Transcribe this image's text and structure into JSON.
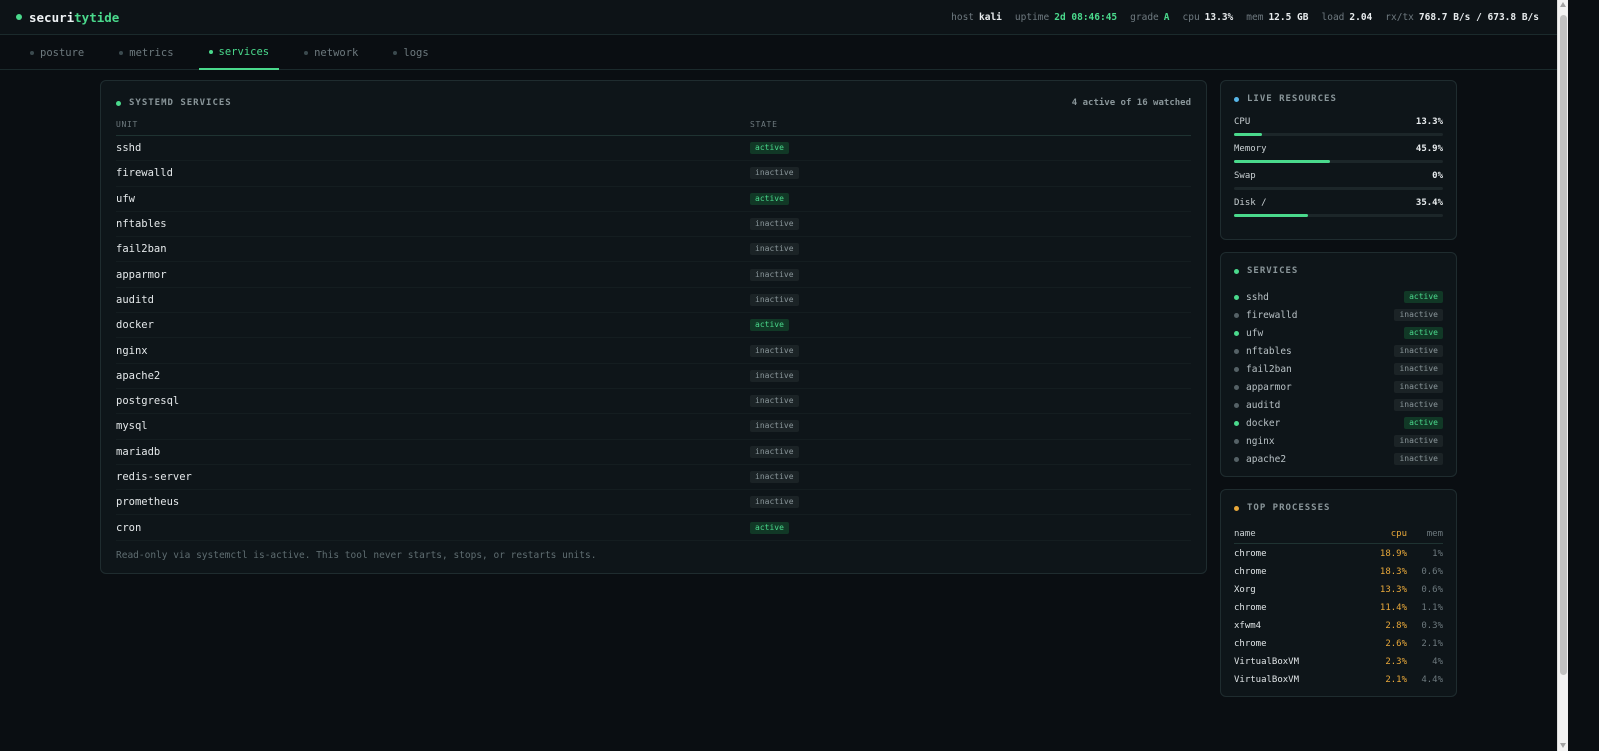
{
  "brand": {
    "prefix": "securi",
    "accent": "tytide"
  },
  "stats": [
    {
      "key": "host",
      "value": "kali"
    },
    {
      "key": "uptime",
      "value": "2d 08:46:45"
    },
    {
      "key": "grade",
      "value": "A"
    },
    {
      "key": "cpu",
      "value": "13.3%"
    },
    {
      "key": "mem",
      "value": "12.5 GB"
    },
    {
      "key": "load",
      "value": "2.04"
    },
    {
      "key": "rx/tx",
      "value": "768.7 B/s / 673.8 B/s"
    }
  ],
  "tabs": [
    "posture",
    "metrics",
    "services",
    "network",
    "logs"
  ],
  "active_tab": "services",
  "main": {
    "title": "SYSTEMD SERVICES",
    "count": "4 active of 16 watched",
    "col_unit": "UNIT",
    "col_state": "STATE",
    "rows": [
      {
        "unit": "sshd",
        "state": "active"
      },
      {
        "unit": "firewalld",
        "state": "inactive"
      },
      {
        "unit": "ufw",
        "state": "active"
      },
      {
        "unit": "nftables",
        "state": "inactive"
      },
      {
        "unit": "fail2ban",
        "state": "inactive"
      },
      {
        "unit": "apparmor",
        "state": "inactive"
      },
      {
        "unit": "auditd",
        "state": "inactive"
      },
      {
        "unit": "docker",
        "state": "active"
      },
      {
        "unit": "nginx",
        "state": "inactive"
      },
      {
        "unit": "apache2",
        "state": "inactive"
      },
      {
        "unit": "postgresql",
        "state": "inactive"
      },
      {
        "unit": "mysql",
        "state": "inactive"
      },
      {
        "unit": "mariadb",
        "state": "inactive"
      },
      {
        "unit": "redis-server",
        "state": "inactive"
      },
      {
        "unit": "prometheus",
        "state": "inactive"
      },
      {
        "unit": "cron",
        "state": "active"
      }
    ],
    "footer": "Read-only via systemctl is-active. This tool never starts, stops, or restarts units."
  },
  "resources": {
    "title": "LIVE RESOURCES",
    "items": [
      {
        "label": "CPU",
        "value": "13.3%",
        "fraction": 0.133
      },
      {
        "label": "Memory",
        "value": "45.9%",
        "fraction": 0.459
      },
      {
        "label": "Swap",
        "value": "0%",
        "fraction": 0
      },
      {
        "label": "Disk /",
        "value": "35.4%",
        "fraction": 0.354
      }
    ]
  },
  "side_services": {
    "title": "SERVICES",
    "items": [
      {
        "unit": "sshd",
        "state": "active"
      },
      {
        "unit": "firewalld",
        "state": "inactive"
      },
      {
        "unit": "ufw",
        "state": "active"
      },
      {
        "unit": "nftables",
        "state": "inactive"
      },
      {
        "unit": "fail2ban",
        "state": "inactive"
      },
      {
        "unit": "apparmor",
        "state": "inactive"
      },
      {
        "unit": "auditd",
        "state": "inactive"
      },
      {
        "unit": "docker",
        "state": "active"
      },
      {
        "unit": "nginx",
        "state": "inactive"
      },
      {
        "unit": "apache2",
        "state": "inactive"
      }
    ]
  },
  "processes": {
    "title": "TOP PROCESSES",
    "headers": {
      "name": "name",
      "cpu": "cpu",
      "mem": "mem"
    },
    "rows": [
      {
        "name": "chrome",
        "cpu": "18.9%",
        "mem": "1%"
      },
      {
        "name": "chrome",
        "cpu": "18.3%",
        "mem": "0.6%"
      },
      {
        "name": "Xorg",
        "cpu": "13.3%",
        "mem": "0.6%"
      },
      {
        "name": "chrome",
        "cpu": "11.4%",
        "mem": "1.1%"
      },
      {
        "name": "xfwm4",
        "cpu": "2.8%",
        "mem": "0.3%"
      },
      {
        "name": "chrome",
        "cpu": "2.6%",
        "mem": "2.1%"
      },
      {
        "name": "VirtualBoxVM",
        "cpu": "2.3%",
        "mem": "4%"
      },
      {
        "name": "VirtualBoxVM",
        "cpu": "2.1%",
        "mem": "4.4%"
      }
    ]
  },
  "colors": {
    "accent": "#4ad98c",
    "bg": "#0a0e12",
    "panel": "#0e1519",
    "cpu": "#e8a83a",
    "info": "#57b6e8"
  }
}
